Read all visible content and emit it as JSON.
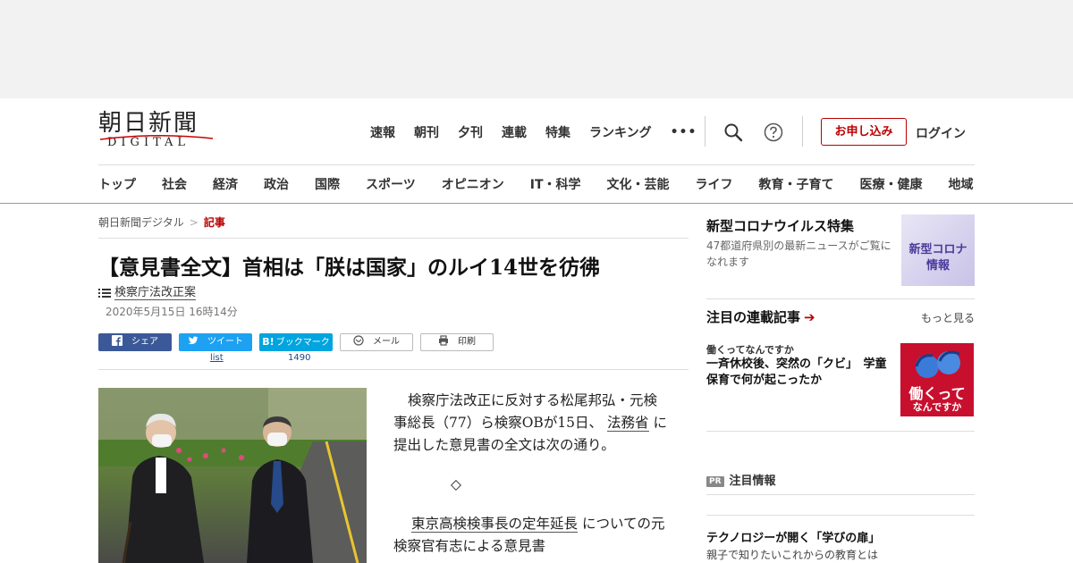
{
  "header": {
    "logo_kanji": "朝日新聞",
    "logo_sub": "DIGITAL",
    "topnav": [
      "速報",
      "朝刊",
      "夕刊",
      "連載",
      "特集",
      "ランキング",
      "•••"
    ],
    "apply_label": "お申し込み",
    "login_label": "ログイン",
    "sections": [
      "トップ",
      "社会",
      "経済",
      "政治",
      "国際",
      "スポーツ",
      "オピニオン",
      "IT・科学",
      "文化・芸能",
      "ライフ",
      "教育・子育て",
      "医療・健康",
      "地域"
    ]
  },
  "breadcrumb": {
    "home": "朝日新聞デジタル",
    "separator": ">",
    "current": "記事"
  },
  "article": {
    "headline": "【意見書全文】首相は「朕は国家」のルイ14世を彷彿",
    "tag": "検察庁法改正案",
    "date": "2020年5月15日 16時14分",
    "share": {
      "facebook": "シェア",
      "twitter": "ツイート",
      "twitter_count": "list",
      "hatena": "ブックマーク",
      "hatena_count": "1490",
      "mail": "メール",
      "print": "印刷"
    },
    "body": {
      "p1_a": "検察庁法改正に反対する松尾邦弘・元検事総長（77）ら検察OBが15日、",
      "p1_link": "法務省",
      "p1_b": "に提出した意見書の全文は次の通り。",
      "diamond": "◇",
      "p2_link": "東京高検検事長の定年延長",
      "p2_b": "についての元検察官有志による意見書"
    }
  },
  "sidebar": {
    "covid_title": "新型コロナウイルス特集",
    "covid_desc": "47都道府県別の最新ニュースがご覧になれます",
    "covid_banner_1": "新型コロナ",
    "covid_banner_2": "情報",
    "series_head": "注目の連載記事",
    "series_arrow": "➔",
    "more_label": "もっと見る",
    "series_kicker": "働くってなんですか",
    "series_title": "一斉休校後、突然の「クビ」　学童保育で何が起こったか",
    "series_thumb_1": "働くって",
    "series_thumb_2": "なんですか",
    "pr_badge": "PR",
    "pr_head": "注目情報",
    "pr_title": "テクノロジーが開く「学びの扉」",
    "pr_sub": "親子で知りたいこれからの教育とは"
  },
  "colors": {
    "accent": "#b00000",
    "facebook": "#3b5998",
    "twitter": "#1da1f2",
    "hatena": "#00a4de"
  }
}
